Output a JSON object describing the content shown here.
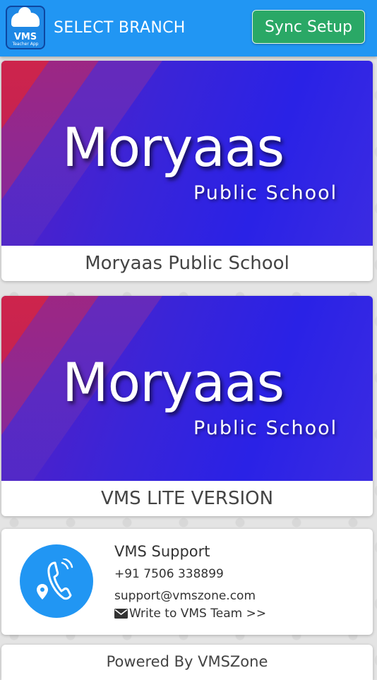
{
  "header": {
    "logo_text": "VMS",
    "logo_subtext": "Teacher App",
    "title": "SELECT BRANCH",
    "sync_label": "Sync Setup"
  },
  "branches": [
    {
      "banner_title": "Moryaas",
      "banner_subtitle": "Public School",
      "name": "Moryaas Public School"
    },
    {
      "banner_title": "Moryaas",
      "banner_subtitle": "Public School",
      "name": "VMS LITE VERSION"
    }
  ],
  "support": {
    "title": "VMS Support",
    "phone": "+91 7506 338899",
    "email": "support@vmszone.com",
    "write_link": "Write to VMS Team >>",
    "icon": "phone-location-icon"
  },
  "footer": {
    "powered_by": "Powered By VMSZone"
  },
  "colors": {
    "topbar": "#2196f3",
    "sync_button": "#2aa866",
    "support_circle": "#2196f3"
  }
}
